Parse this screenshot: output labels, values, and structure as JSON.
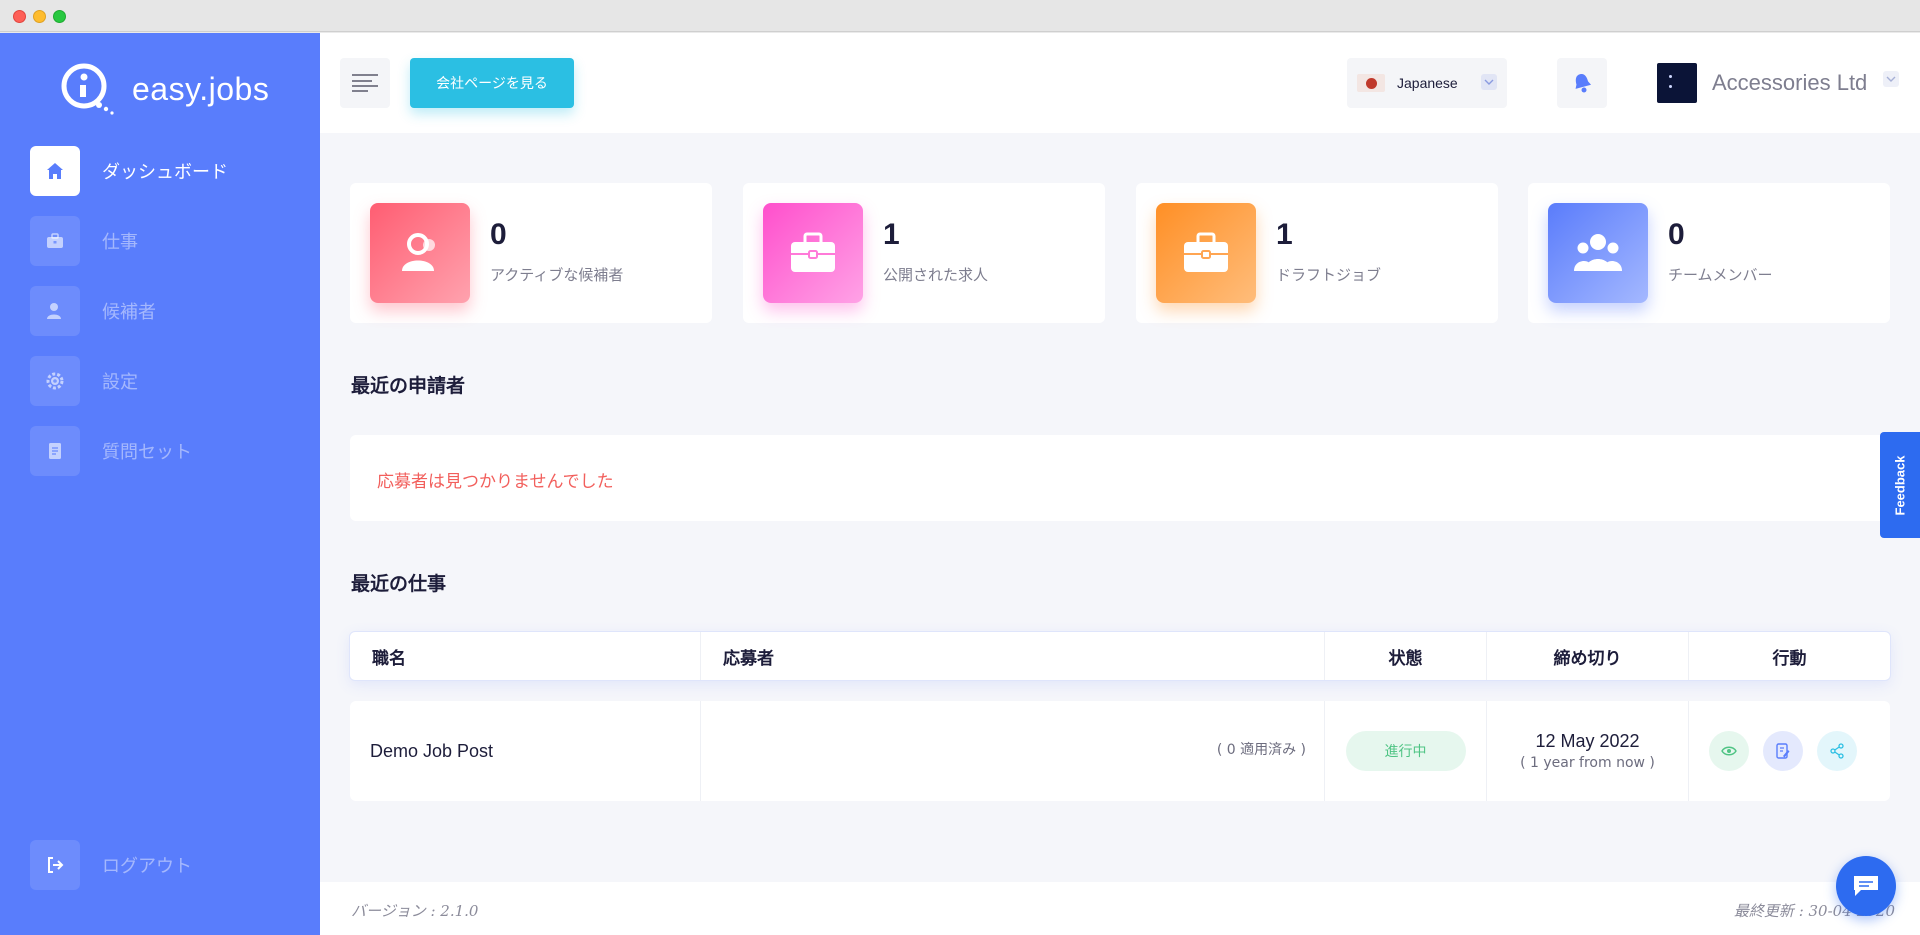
{
  "app": {
    "logo_text": "easy.jobs"
  },
  "sidebar": {
    "items": [
      {
        "label": "ダッシュボード",
        "icon": "home-icon",
        "active": true
      },
      {
        "label": "仕事",
        "icon": "briefcase-icon",
        "active": false
      },
      {
        "label": "候補者",
        "icon": "user-icon",
        "active": false
      },
      {
        "label": "設定",
        "icon": "gear-icon",
        "active": false
      },
      {
        "label": "質問セット",
        "icon": "document-icon",
        "active": false
      }
    ],
    "logout_label": "ログアウト"
  },
  "topbar": {
    "company_page_button": "会社ページを見る",
    "language": "Japanese",
    "company_name": "Accessories Ltd"
  },
  "stats": [
    {
      "value": "0",
      "label": "アクティブな候補者",
      "icon": "users-icon",
      "color": "#ff6b7d"
    },
    {
      "value": "1",
      "label": "公開された求人",
      "icon": "briefcase-icon",
      "color": "#ff64d1"
    },
    {
      "value": "1",
      "label": "ドラフトジョブ",
      "icon": "briefcase-icon",
      "color": "#ff9b38"
    },
    {
      "value": "0",
      "label": "チームメンバー",
      "icon": "team-icon",
      "color": "#5f82fb"
    }
  ],
  "recent_applicants": {
    "title": "最近の申請者",
    "empty_message": "応募者は見つかりませんでした"
  },
  "recent_jobs": {
    "title": "最近の仕事",
    "columns": [
      "職名",
      "応募者",
      "状態",
      "締め切り",
      "行動"
    ],
    "rows": [
      {
        "title": "Demo Job Post",
        "applicants": "( 0 適用済み )",
        "status": "進行中",
        "deadline": "12 May 2022",
        "deadline_relative": "( 1 year from now )"
      }
    ]
  },
  "footer": {
    "version": "バージョン : 2.1.0",
    "last_updated": "最終更新 : 30-04-2020"
  },
  "feedback_label": "Feedback",
  "colors": {
    "sidebar": "#597dfc",
    "accent": "#2bbfe3",
    "status_green": "#4fc484",
    "error": "#f25f5c"
  }
}
